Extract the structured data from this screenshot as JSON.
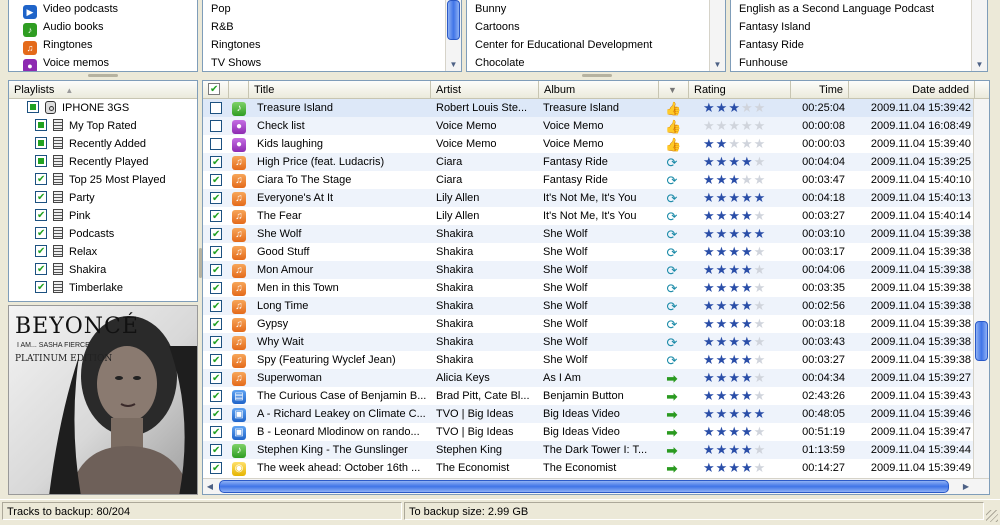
{
  "browser": {
    "col1": [
      {
        "label": "Video podcasts",
        "icon": "video-podcast-icon",
        "color": "#1f64c9"
      },
      {
        "label": "Audio books",
        "icon": "audiobook-icon",
        "color": "#2f9d22"
      },
      {
        "label": "Ringtones",
        "icon": "bell-icon",
        "color": "#e46a1a"
      },
      {
        "label": "Voice memos",
        "icon": "microphone-icon",
        "color": "#8d2ab1"
      }
    ],
    "col2": [
      "Pop",
      "R&B",
      "Ringtones",
      "TV Shows"
    ],
    "col3": [
      "Bunny",
      "Cartoons",
      "Center for Educational Development",
      "Chocolate"
    ],
    "col4": [
      "English as a Second Language Podcast",
      "Fantasy Island",
      "Fantasy Ride",
      "Funhouse"
    ]
  },
  "playlists": {
    "header": "Playlists",
    "device": "IPHONE 3GS",
    "items": [
      "My Top Rated",
      "Recently Added",
      "Recently Played",
      "Top 25 Most Played",
      "Party",
      "Pink",
      "Podcasts",
      "Relax",
      "Shakira",
      "Timberlake"
    ]
  },
  "artwork": {
    "line1": "BEYONCÉ",
    "line2": "I AM... SASHA FIERCE",
    "line3": "PLATINUM EDITION"
  },
  "table": {
    "headers": {
      "title": "Title",
      "artist": "Artist",
      "album": "Album",
      "rating": "Rating",
      "time": "Time",
      "date": "Date added"
    },
    "rows": [
      {
        "checked": false,
        "type": "audio",
        "title": "Treasure Island",
        "artist": "Robert Louis Ste...",
        "album": "Treasure Island",
        "status": "thumb",
        "rating": 3,
        "time": "00:25:04",
        "date": "2009.11.04 15:39:42"
      },
      {
        "checked": false,
        "type": "memo",
        "title": "Check list",
        "artist": "Voice Memo",
        "album": "Voice Memo",
        "status": "thumb",
        "rating": 0,
        "time": "00:00:08",
        "date": "2009.11.04 16:08:49"
      },
      {
        "checked": false,
        "type": "memo",
        "title": "Kids laughing",
        "artist": "Voice Memo",
        "album": "Voice Memo",
        "status": "thumb",
        "rating": 2,
        "time": "00:00:03",
        "date": "2009.11.04 15:39:40"
      },
      {
        "checked": true,
        "type": "music",
        "title": "High Price (feat. Ludacris)",
        "artist": "Ciara",
        "album": "Fantasy Ride",
        "status": "sync",
        "rating": 4,
        "time": "00:04:04",
        "date": "2009.11.04 15:39:25"
      },
      {
        "checked": true,
        "type": "music",
        "title": "Ciara To The Stage",
        "artist": "Ciara",
        "album": "Fantasy Ride",
        "status": "sync",
        "rating": 3,
        "time": "00:03:47",
        "date": "2009.11.04 15:40:10"
      },
      {
        "checked": true,
        "type": "music",
        "title": "Everyone's At It",
        "artist": "Lily Allen",
        "album": "It's Not Me, It's You",
        "status": "sync",
        "rating": 5,
        "time": "00:04:18",
        "date": "2009.11.04 15:40:13"
      },
      {
        "checked": true,
        "type": "music",
        "title": "The Fear",
        "artist": "Lily Allen",
        "album": "It's Not Me, It's You",
        "status": "sync",
        "rating": 4,
        "time": "00:03:27",
        "date": "2009.11.04 15:40:14"
      },
      {
        "checked": true,
        "type": "music",
        "title": "She Wolf",
        "artist": "Shakira",
        "album": "She Wolf",
        "status": "sync",
        "rating": 5,
        "time": "00:03:10",
        "date": "2009.11.04 15:39:38"
      },
      {
        "checked": true,
        "type": "music",
        "title": "Good Stuff",
        "artist": "Shakira",
        "album": "She Wolf",
        "status": "sync",
        "rating": 4,
        "time": "00:03:17",
        "date": "2009.11.04 15:39:38"
      },
      {
        "checked": true,
        "type": "music",
        "title": "Mon Amour",
        "artist": "Shakira",
        "album": "She Wolf",
        "status": "sync",
        "rating": 4,
        "time": "00:04:06",
        "date": "2009.11.04 15:39:38"
      },
      {
        "checked": true,
        "type": "music",
        "title": "Men in this Town",
        "artist": "Shakira",
        "album": "She Wolf",
        "status": "sync",
        "rating": 4,
        "time": "00:03:35",
        "date": "2009.11.04 15:39:38"
      },
      {
        "checked": true,
        "type": "music",
        "title": "Long Time",
        "artist": "Shakira",
        "album": "She Wolf",
        "status": "sync",
        "rating": 4,
        "time": "00:02:56",
        "date": "2009.11.04 15:39:38"
      },
      {
        "checked": true,
        "type": "music",
        "title": "Gypsy",
        "artist": "Shakira",
        "album": "She Wolf",
        "status": "sync",
        "rating": 4,
        "time": "00:03:18",
        "date": "2009.11.04 15:39:38"
      },
      {
        "checked": true,
        "type": "music",
        "title": "Why Wait",
        "artist": "Shakira",
        "album": "She Wolf",
        "status": "sync",
        "rating": 4,
        "time": "00:03:43",
        "date": "2009.11.04 15:39:38"
      },
      {
        "checked": true,
        "type": "music",
        "title": "Spy (Featuring Wyclef Jean)",
        "artist": "Shakira",
        "album": "She Wolf",
        "status": "sync",
        "rating": 4,
        "time": "00:03:27",
        "date": "2009.11.04 15:39:38"
      },
      {
        "checked": true,
        "type": "music",
        "title": "Superwoman",
        "artist": "Alicia Keys",
        "album": "As I Am",
        "status": "arrow",
        "rating": 4,
        "time": "00:04:34",
        "date": "2009.11.04 15:39:27"
      },
      {
        "checked": true,
        "type": "video",
        "title": "The Curious Case of Benjamin B...",
        "artist": "Brad Pitt, Cate Bl...",
        "album": "Benjamin Button",
        "status": "arrow",
        "rating": 4,
        "time": "02:43:26",
        "date": "2009.11.04 15:39:43"
      },
      {
        "checked": true,
        "type": "tv",
        "title": "A - Richard Leakey on Climate C...",
        "artist": "TVO | Big Ideas",
        "album": "Big Ideas Video",
        "status": "arrow",
        "rating": 5,
        "time": "00:48:05",
        "date": "2009.11.04 15:39:46"
      },
      {
        "checked": true,
        "type": "tv",
        "title": "B - Leonard Mlodinow on rando...",
        "artist": "TVO | Big Ideas",
        "album": "Big Ideas Video",
        "status": "arrow",
        "rating": 4,
        "time": "00:51:19",
        "date": "2009.11.04 15:39:47"
      },
      {
        "checked": true,
        "type": "audio",
        "title": "Stephen King - The Gunslinger",
        "artist": "Stephen King",
        "album": "The Dark Tower I: T...",
        "status": "arrow",
        "rating": 4,
        "time": "01:13:59",
        "date": "2009.11.04 15:39:44"
      },
      {
        "checked": true,
        "type": "pod",
        "title": "The week ahead: October 16th ...",
        "artist": "The Economist",
        "album": "The Economist",
        "status": "arrow",
        "rating": 4,
        "time": "00:14:27",
        "date": "2009.11.04 15:39:49"
      }
    ]
  },
  "status": {
    "tracks": "Tracks to backup: 80/204",
    "size": "To backup size: 2.99 GB"
  },
  "colors": {
    "star": "#2a4ea8",
    "star_off": "#d0d4dc",
    "scroll": "#3f74e8"
  }
}
